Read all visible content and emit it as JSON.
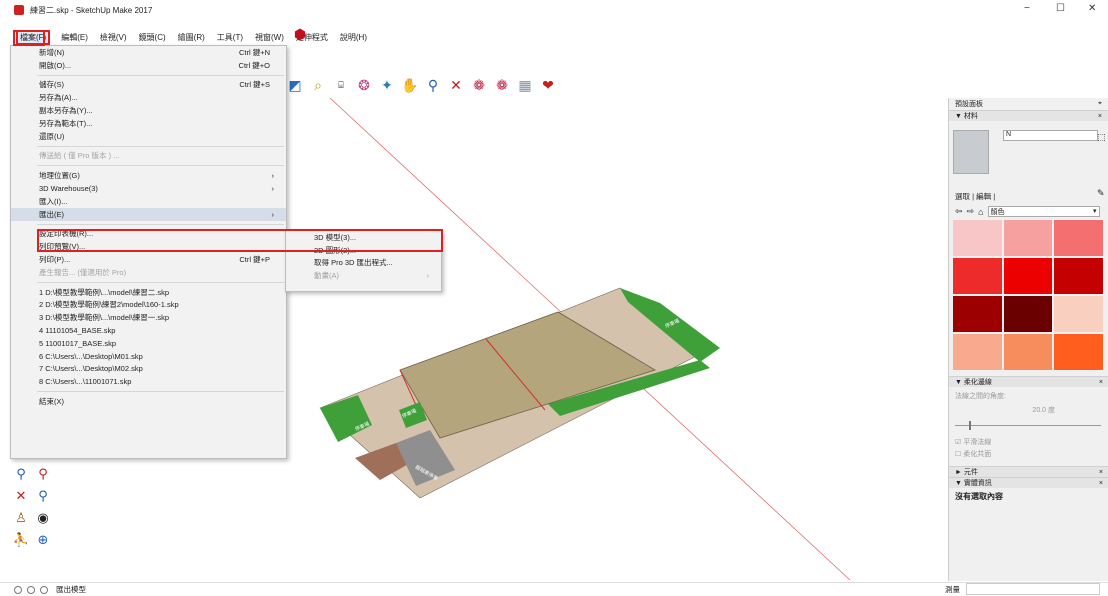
{
  "window": {
    "title": "練習二.skp - SketchUp Make 2017",
    "minimize": "−",
    "restore": "☐",
    "close": "✕"
  },
  "menubar": [
    "檔案(F)",
    "編輯(E)",
    "檢視(V)",
    "鏡頭(C)",
    "繪圖(R)",
    "工具(T)",
    "視窗(W)",
    "延伸程式",
    "說明(H)"
  ],
  "file_menu": [
    {
      "label": "新增(N)",
      "shortcut": "Ctrl 鍵+N"
    },
    {
      "label": "開啟(O)...",
      "shortcut": "Ctrl 鍵+O"
    },
    {
      "sep": true
    },
    {
      "label": "儲存(S)",
      "shortcut": "Ctrl 鍵+S"
    },
    {
      "label": "另存為(A)..."
    },
    {
      "label": "副本另存為(Y)..."
    },
    {
      "label": "另存為範本(T)..."
    },
    {
      "label": "還原(U)"
    },
    {
      "sep": true
    },
    {
      "label": "傳送給 ( 僅 Pro 版本 ) ...",
      "disabled": true
    },
    {
      "sep": true
    },
    {
      "label": "地理位置(G)",
      "arrow": "›"
    },
    {
      "label": "3D Warehouse(3)",
      "arrow": "›"
    },
    {
      "label": "匯入(I)..."
    },
    {
      "label": "匯出(E)",
      "arrow": "›",
      "highlighted": true
    },
    {
      "sep": true
    },
    {
      "label": "設定印表機(R)..."
    },
    {
      "label": "列印預覽(V)..."
    },
    {
      "label": "列印(P)...",
      "shortcut": "Ctrl 鍵+P"
    },
    {
      "label": "產生報告... (僅適用於 Pro)",
      "disabled": true
    },
    {
      "sep": true
    },
    {
      "label": "1 D:\\模型教學範例\\...\\model\\練習二.skp"
    },
    {
      "label": "2 D:\\模型教學範例\\練習2\\model\\160-1.skp"
    },
    {
      "label": "3 D:\\模型教學範例\\...\\model\\練習一.skp"
    },
    {
      "label": "4 11101054_BASE.skp"
    },
    {
      "label": "5 11001017_BASE.skp"
    },
    {
      "label": "6 C:\\Users\\...\\Desktop\\M01.skp"
    },
    {
      "label": "7 C:\\Users\\...\\Desktop\\M02.skp"
    },
    {
      "label": "8 C:\\Users\\...\\11001071.skp"
    },
    {
      "sep": true
    },
    {
      "label": "結束(X)"
    }
  ],
  "export_submenu": [
    {
      "label": "3D 模型(3)..."
    },
    {
      "label": "2D 圖形(2)..."
    },
    {
      "label": "取得 Pro 3D 匯出程式..."
    },
    {
      "label": "動畫(A)",
      "arrow": "›",
      "disabled": true
    }
  ],
  "tray": {
    "title": "預設面板",
    "materials": "▼ 材料",
    "material_name": "N",
    "tab_select": "選取",
    "tab_edit": "編輯",
    "color_set": "顏色",
    "swatches": [
      "#f8c6c6",
      "#f7a0a0",
      "#f47070",
      "#ee2b2b",
      "#ed0000",
      "#c40000",
      "#9c0000",
      "#6a0000",
      "#f9d0c0",
      "#f9a98e",
      "#f78c5c",
      "#ff5e1e"
    ],
    "soften": "▼ 柔化邊線",
    "normals_angle": "法線之間的角度:",
    "degrees": "20.0 度",
    "smooth_normals": "☑ 平滑法線",
    "soften_coplanar": "☐ 柔化共面",
    "components": "► 元件",
    "entity_info": "▼ 實體資訊",
    "no_selection": "沒有選取內容"
  },
  "model_labels": [
    "停車場",
    "停車場",
    "停車場",
    "腳踏車停車"
  ],
  "status": {
    "text": "匯出模型",
    "measure_label": "測量"
  }
}
